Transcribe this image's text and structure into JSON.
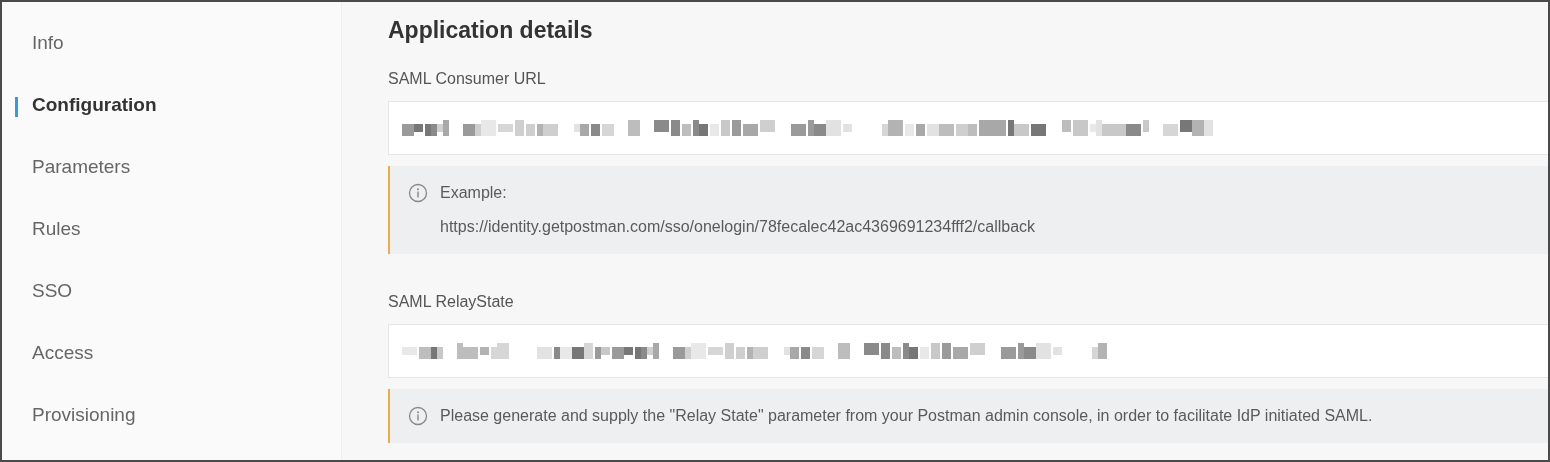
{
  "sidebar": {
    "items": [
      {
        "label": "Info",
        "selected": false
      },
      {
        "label": "Configuration",
        "selected": true
      },
      {
        "label": "Parameters",
        "selected": false
      },
      {
        "label": "Rules",
        "selected": false
      },
      {
        "label": "SSO",
        "selected": false
      },
      {
        "label": "Access",
        "selected": false
      },
      {
        "label": "Provisioning",
        "selected": false
      }
    ]
  },
  "main": {
    "title": "Application details",
    "fields": [
      {
        "label": "SAML Consumer URL",
        "redacted": true,
        "note": {
          "lines": [
            "Example:",
            "https://identity.getpostman.com/sso/onelogin/78fecalec42ac4369691234fff2/callback"
          ]
        }
      },
      {
        "label": "SAML RelayState",
        "redacted": true,
        "note": {
          "lines": [
            "Please generate and supply the \"Relay State\" parameter from your Postman admin console, in order to facilitate IdP initiated SAML."
          ]
        }
      }
    ]
  }
}
